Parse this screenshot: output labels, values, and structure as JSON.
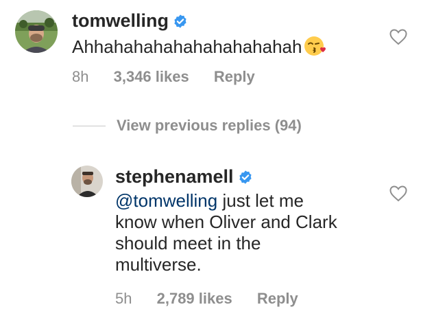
{
  "comments": [
    {
      "username": "tomwelling",
      "text": "Ahhahahahahahahahahahah",
      "emoji": "face-blowing-kiss",
      "time": "8h",
      "likes": "3,346 likes",
      "reply_label": "Reply"
    },
    {
      "username": "stephenamell",
      "mention": "@tomwelling",
      "text_line1": " just let me",
      "text_line2": "know when Oliver and Clark",
      "text_line3": "should meet in the",
      "text_line4": "multiverse.",
      "time": "5h",
      "likes": "2,789 likes",
      "reply_label": "Reply"
    }
  ],
  "view_replies": "View previous replies (94)",
  "colors": {
    "text": "#262626",
    "meta": "#8e8e8e",
    "mention": "#003569",
    "verified": "#3897f0"
  }
}
